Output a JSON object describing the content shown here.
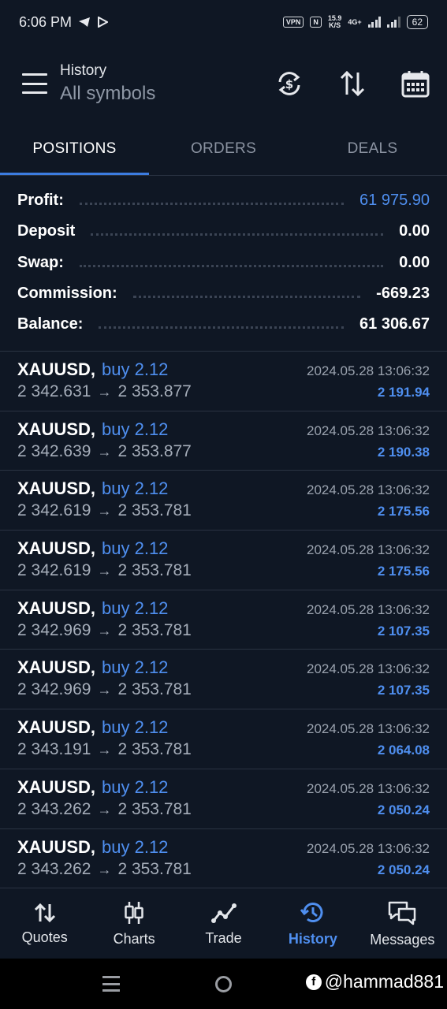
{
  "status_bar": {
    "time": "6:06 PM",
    "vpn": "VPN",
    "nfc": "N",
    "speed_value": "15.9",
    "speed_unit": "K/S",
    "network": "4G+",
    "battery": "62"
  },
  "header": {
    "title_small": "History",
    "title_big": "All symbols",
    "icons": [
      "menu-icon",
      "currency-swap-icon",
      "sort-icon",
      "calendar-icon"
    ]
  },
  "tabs": [
    {
      "label": "POSITIONS",
      "active": true
    },
    {
      "label": "ORDERS",
      "active": false
    },
    {
      "label": "DEALS",
      "active": false
    }
  ],
  "summary": [
    {
      "label": "Profit:",
      "value": "61 975.90",
      "accent": true
    },
    {
      "label": "Deposit",
      "value": "0.00",
      "accent": false
    },
    {
      "label": "Swap:",
      "value": "0.00",
      "accent": false
    },
    {
      "label": "Commission:",
      "value": "-669.23",
      "accent": false
    },
    {
      "label": "Balance:",
      "value": "61 306.67",
      "accent": false
    }
  ],
  "deals": [
    {
      "symbol": "XAUUSD,",
      "type": "buy 2.12",
      "time": "2024.05.28 13:06:32",
      "open": "2 342.631",
      "close": "2 353.877",
      "profit": "2 191.94"
    },
    {
      "symbol": "XAUUSD,",
      "type": "buy 2.12",
      "time": "2024.05.28 13:06:32",
      "open": "2 342.639",
      "close": "2 353.877",
      "profit": "2 190.38"
    },
    {
      "symbol": "XAUUSD,",
      "type": "buy 2.12",
      "time": "2024.05.28 13:06:32",
      "open": "2 342.619",
      "close": "2 353.781",
      "profit": "2 175.56"
    },
    {
      "symbol": "XAUUSD,",
      "type": "buy 2.12",
      "time": "2024.05.28 13:06:32",
      "open": "2 342.619",
      "close": "2 353.781",
      "profit": "2 175.56"
    },
    {
      "symbol": "XAUUSD,",
      "type": "buy 2.12",
      "time": "2024.05.28 13:06:32",
      "open": "2 342.969",
      "close": "2 353.781",
      "profit": "2 107.35"
    },
    {
      "symbol": "XAUUSD,",
      "type": "buy 2.12",
      "time": "2024.05.28 13:06:32",
      "open": "2 342.969",
      "close": "2 353.781",
      "profit": "2 107.35"
    },
    {
      "symbol": "XAUUSD,",
      "type": "buy 2.12",
      "time": "2024.05.28 13:06:32",
      "open": "2 343.191",
      "close": "2 353.781",
      "profit": "2 064.08"
    },
    {
      "symbol": "XAUUSD,",
      "type": "buy 2.12",
      "time": "2024.05.28 13:06:32",
      "open": "2 343.262",
      "close": "2 353.781",
      "profit": "2 050.24"
    },
    {
      "symbol": "XAUUSD,",
      "type": "buy 2.12",
      "time": "2024.05.28 13:06:32",
      "open": "2 343.262",
      "close": "2 353.781",
      "profit": "2 050.24"
    }
  ],
  "arrow": "→",
  "bottom_nav": [
    {
      "label": "Quotes",
      "icon": "quotes-icon",
      "active": false
    },
    {
      "label": "Charts",
      "icon": "charts-icon",
      "active": false
    },
    {
      "label": "Trade",
      "icon": "trade-icon",
      "active": false
    },
    {
      "label": "History",
      "icon": "history-icon",
      "active": true
    },
    {
      "label": "Messages",
      "icon": "messages-icon",
      "active": false
    }
  ],
  "watermark": "@hammad881",
  "colors": {
    "background": "#0f1724",
    "accent": "#4f8ff0",
    "tab_indicator": "#3c7ce0",
    "muted": "#8b93a1"
  }
}
